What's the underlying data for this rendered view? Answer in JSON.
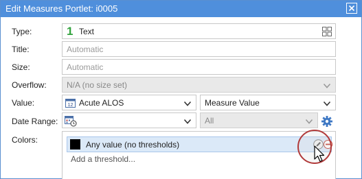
{
  "dialog": {
    "title": "Edit Measures Portlet: i0005"
  },
  "type": {
    "label": "Type:",
    "icon_glyph": "1",
    "value": "Text",
    "icon": "grid-icon"
  },
  "title": {
    "label": "Title:",
    "placeholder": "Automatic"
  },
  "size": {
    "label": "Size:",
    "placeholder": "Automatic"
  },
  "overflow": {
    "label": "Overflow:",
    "value": "N/A (no size set)"
  },
  "value": {
    "label": "Value:",
    "calendar_number": "12",
    "measure": "Acute ALOS",
    "display": "Measure Value"
  },
  "date_range": {
    "label": "Date Range:",
    "value": "",
    "scope": "All"
  },
  "colors": {
    "label": "Colors:",
    "rows": [
      {
        "swatch": "#000000",
        "label": "Any value (no thresholds)"
      }
    ],
    "add_label": "Add a threshold..."
  },
  "theme": {
    "titlebar": "#4f8fdc",
    "accent_green": "#31a23d",
    "highlight_ring": "#b13a3a"
  }
}
